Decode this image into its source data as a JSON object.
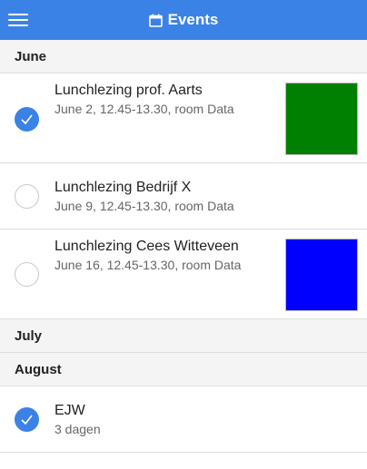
{
  "header": {
    "title": "Events",
    "menu_icon": "hamburger-menu-icon",
    "title_icon": "calendar-icon"
  },
  "sections": [
    {
      "label": "June",
      "items": [
        {
          "title": "Lunchlezing prof. Aarts",
          "subtitle": "June 2, 12.45-13.30, room Data",
          "checked": true,
          "thumb_color": "#008000"
        },
        {
          "title": "Lunchlezing Bedrijf X",
          "subtitle": "June 9, 12.45-13.30, room Data",
          "checked": false
        },
        {
          "title": "Lunchlezing Cees Witteveen",
          "subtitle": "June 16, 12.45-13.30, room Data",
          "checked": false,
          "thumb_color": "#0000ff"
        }
      ]
    },
    {
      "label": "July",
      "items": []
    },
    {
      "label": "August",
      "items": [
        {
          "title": "EJW",
          "subtitle": "3 dagen",
          "checked": true
        }
      ]
    }
  ],
  "colors": {
    "accent": "#3b82e6"
  }
}
